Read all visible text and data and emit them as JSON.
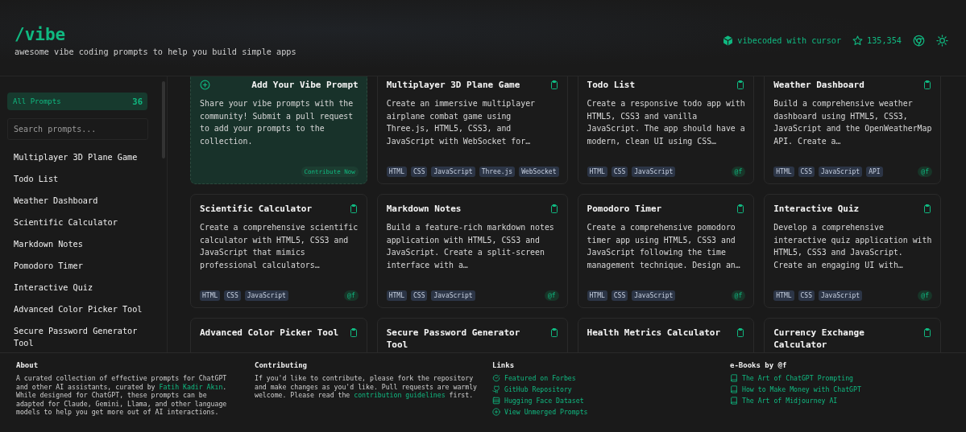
{
  "header": {
    "title": "/vibe",
    "subtitle": "awesome vibe coding prompts to help you build simple apps",
    "links": [
      {
        "kind": "cursor",
        "text": "vibecoded with cursor"
      },
      {
        "kind": "stars",
        "text": "135,354"
      },
      {
        "kind": "chrome"
      },
      {
        "kind": "theme"
      }
    ]
  },
  "sidebar": {
    "filter": {
      "label": "All Prompts",
      "count": "36",
      "selected": true
    },
    "search": {
      "placeholder": "Search prompts..."
    },
    "items": [
      {
        "label": "Multiplayer 3D Plane Game"
      },
      {
        "label": "Todo List"
      },
      {
        "label": "Weather Dashboard"
      },
      {
        "label": "Scientific Calculator"
      },
      {
        "label": "Markdown Notes"
      },
      {
        "label": "Pomodoro Timer"
      },
      {
        "label": "Interactive Quiz"
      },
      {
        "label": "Advanced Color Picker Tool"
      },
      {
        "label": "Secure Password Generator Tool"
      }
    ]
  },
  "cards": [
    {
      "kind": "add",
      "title": "Add Your Vibe Prompt",
      "description": "Share your vibe prompts with the community! Submit a pull request to add your prompts to the collection.",
      "action": "Contribute Now"
    },
    {
      "kind": "prompt",
      "title": "Multiplayer 3D Plane Game",
      "description": "Create an immersive multiplayer airplane combat game using Three.js, HTML5, CSS3, and JavaScript with WebSocket for…",
      "tags": [
        "HTML",
        "CSS",
        "JavaScript",
        "Three.js",
        "WebSocket"
      ]
    },
    {
      "kind": "prompt",
      "title": "Todo List",
      "description": "Create a responsive todo app with HTML5, CSS3 and vanilla JavaScript. The app should have a modern, clean UI using CSS…",
      "tags": [
        "HTML",
        "CSS",
        "JavaScript"
      ],
      "author": "@f"
    },
    {
      "kind": "prompt",
      "title": "Weather Dashboard",
      "description": "Build a comprehensive weather dashboard using HTML5, CSS3, JavaScript and the OpenWeatherMap API. Create a…",
      "tags": [
        "HTML",
        "CSS",
        "JavaScript",
        "API"
      ],
      "author": "@f"
    },
    {
      "kind": "prompt",
      "title": "Scientific Calculator",
      "description": "Create a comprehensive scientific calculator with HTML5, CSS3 and JavaScript that mimics professional calculators…",
      "tags": [
        "HTML",
        "CSS",
        "JavaScript"
      ],
      "author": "@f"
    },
    {
      "kind": "prompt",
      "title": "Markdown Notes",
      "description": "Build a feature-rich markdown notes application with HTML5, CSS3 and JavaScript. Create a split-screen interface with a…",
      "tags": [
        "HTML",
        "CSS",
        "JavaScript"
      ],
      "author": "@f"
    },
    {
      "kind": "prompt",
      "title": "Pomodoro Timer",
      "description": "Create a comprehensive pomodoro timer app using HTML5, CSS3 and JavaScript following the time management technique. Design an…",
      "tags": [
        "HTML",
        "CSS",
        "JavaScript"
      ],
      "author": "@f"
    },
    {
      "kind": "prompt",
      "title": "Interactive Quiz",
      "description": "Develop a comprehensive interactive quiz application with HTML5, CSS3 and JavaScript. Create an engaging UI with…",
      "tags": [
        "HTML",
        "CSS",
        "JavaScript"
      ],
      "author": "@f"
    },
    {
      "kind": "prompt",
      "title": "Advanced Color Picker Tool"
    },
    {
      "kind": "prompt",
      "title": "Secure Password Generator Tool"
    },
    {
      "kind": "prompt",
      "title": "Health Metrics Calculator"
    },
    {
      "kind": "prompt",
      "title": "Currency Exchange Calculator"
    }
  ],
  "footer": {
    "about": {
      "title": "About",
      "text": [
        {
          "text": "A curated collection of effective prompts for ChatGPT and other AI assistants, curated by "
        },
        {
          "link": "Fatih Kadir Akın"
        },
        {
          "text": ". While designed for ChatGPT, these prompts can be adapted for Claude, Gemini, Llama, and other language models to help you get more out of AI interactions."
        }
      ]
    },
    "contributing": {
      "title": "Contributing",
      "text": [
        {
          "text": "If you'd like to contribute, please fork the repository and make changes as you'd like. Pull requests are warmly welcome. Please read the "
        },
        {
          "link": "contribution guidelines"
        },
        {
          "text": " first."
        }
      ]
    },
    "links": {
      "title": "Links",
      "items": [
        {
          "kind": "check",
          "label": "Featured on Forbes"
        },
        {
          "kind": "github",
          "label": "GitHub Repository"
        },
        {
          "kind": "dataset",
          "label": "Hugging Face Dataset"
        },
        {
          "kind": "plus",
          "label": "View Unmerged Prompts"
        }
      ]
    },
    "ebooks": {
      "title": "e-Books by @f",
      "items": [
        {
          "kind": "book",
          "label": "The Art of ChatGPT Prompting"
        },
        {
          "kind": "book",
          "label": "How to Make Money with ChatGPT"
        },
        {
          "kind": "book",
          "label": "The Art of Midjourney AI"
        }
      ]
    }
  }
}
